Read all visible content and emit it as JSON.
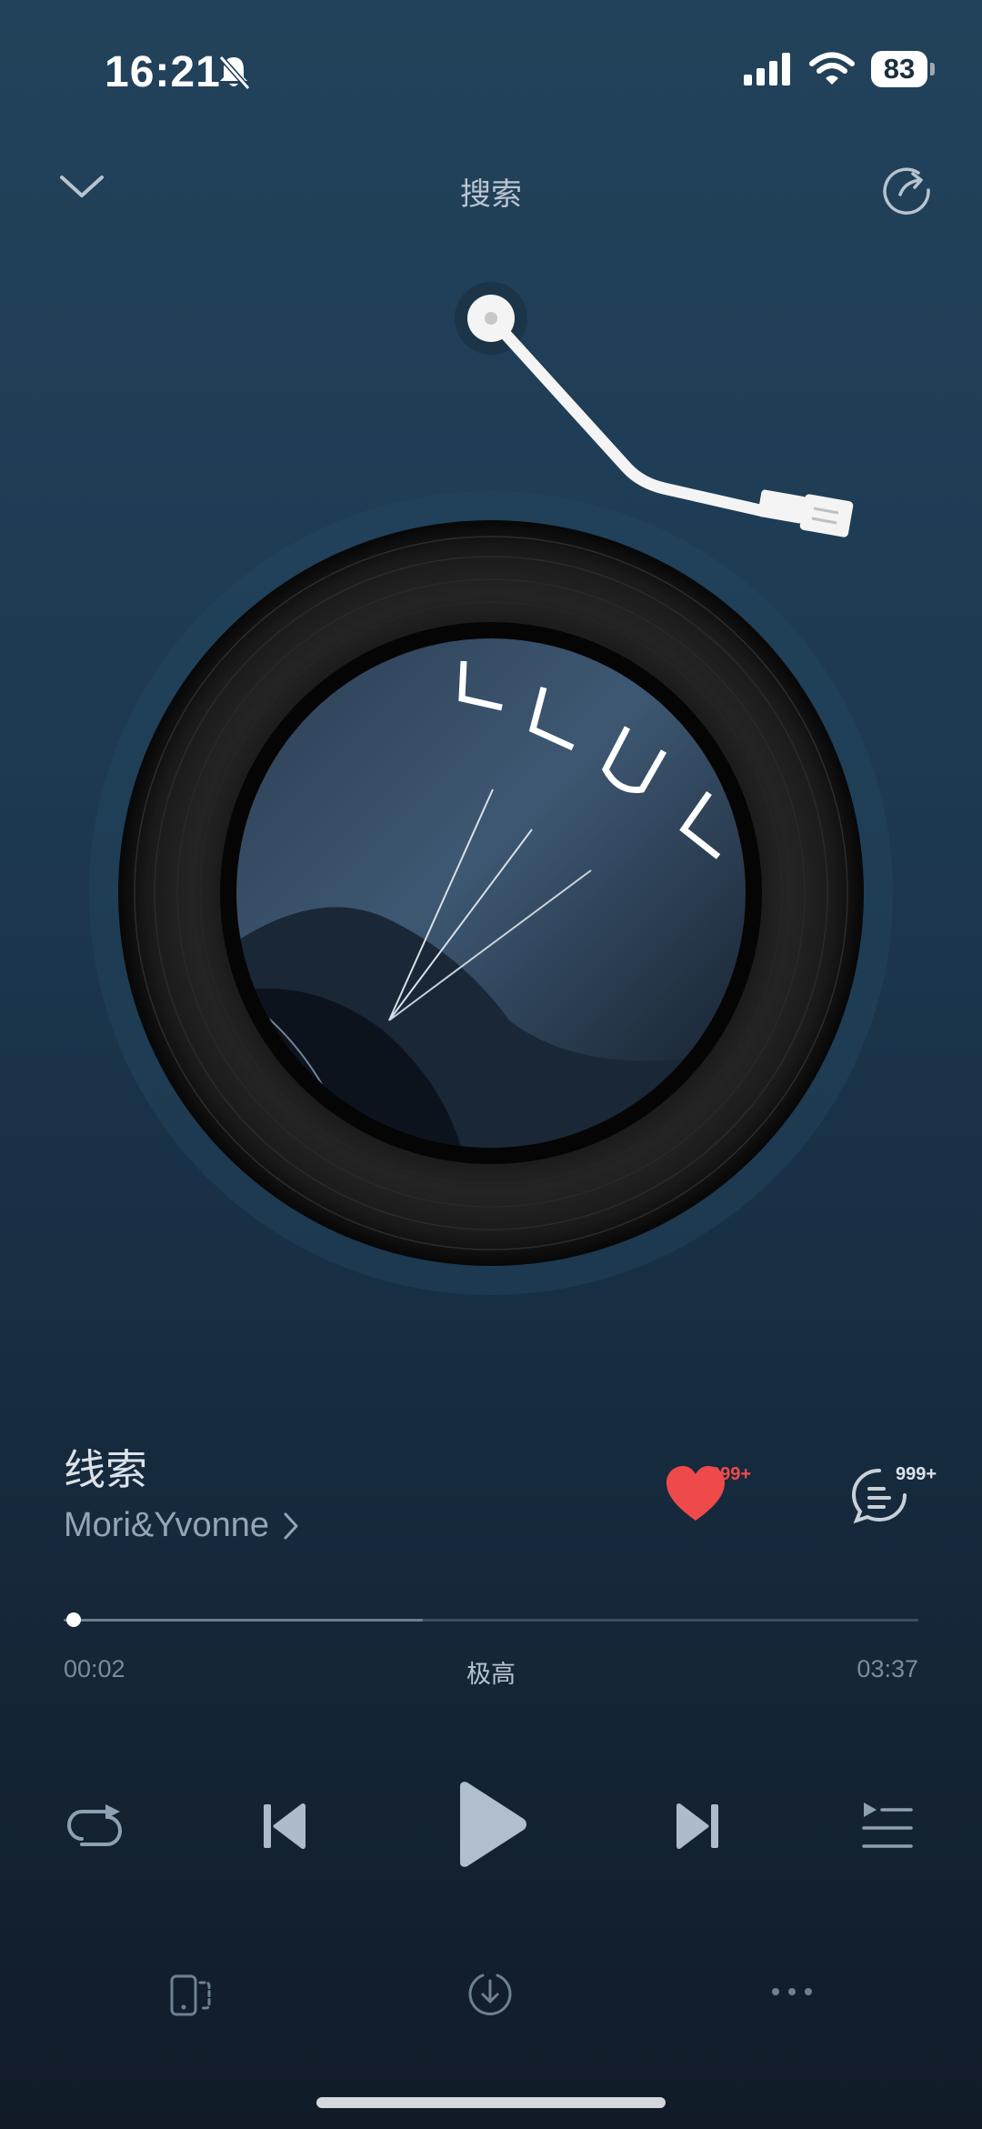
{
  "status_bar": {
    "time": "16:21",
    "battery": "83"
  },
  "header": {
    "title": "搜索"
  },
  "song": {
    "title": "线索",
    "artist": "Mori&Yvonne",
    "like_count": "999+",
    "comment_count": "999+"
  },
  "progress": {
    "elapsed": "00:02",
    "duration": "03:37",
    "quality": "极高",
    "position": 0.01,
    "buffered": 0.42
  },
  "controls": [
    "repeat-icon",
    "previous-icon",
    "play-icon",
    "next-icon",
    "playlist-icon"
  ],
  "bottom_bar": [
    "device-icon",
    "download-icon",
    "more-icon"
  ],
  "colors": {
    "accent_like": "#ef4a4a",
    "background_top": "#22425b",
    "background_bottom": "#111b28"
  }
}
